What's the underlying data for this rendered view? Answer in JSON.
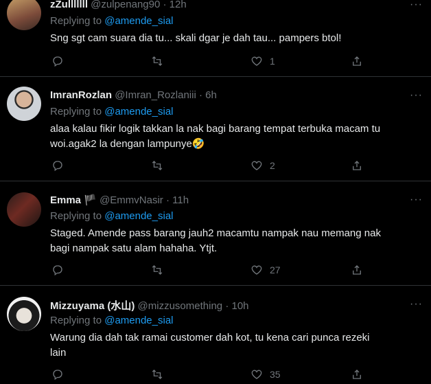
{
  "tweets": [
    {
      "name": "zZulllllll",
      "handle": "@zulpenang90",
      "sep": "·",
      "time": "12h",
      "replying_prefix": "Replying to",
      "replying_to": "@amende_sial",
      "text": "Sng sgt cam suara dia tu... skali dgar je dah tau... pampers btol!",
      "likes": "1",
      "more": "···"
    },
    {
      "name": "ImranRozlan",
      "handle": "@Imran_Rozlaniii",
      "sep": "·",
      "time": "6h",
      "replying_prefix": "Replying to",
      "replying_to": "@amende_sial",
      "text_line1": "alaa kalau fikir logik takkan la nak bagi barang tempat terbuka macam tu",
      "text_line2": "woi.agak2 la dengan lampunye🤣",
      "likes": "2",
      "more": "···"
    },
    {
      "name": "Emma",
      "handle": "@EmmvNasir",
      "sep": "·",
      "time": "11h",
      "replying_prefix": "Replying to",
      "replying_to": "@amende_sial",
      "text_line1": "Staged. Amende pass barang jauh2 macamtu nampak nau memang nak",
      "text_line2": "bagi nampak satu alam hahaha. Ytjt.",
      "likes": "27",
      "more": "···"
    },
    {
      "name": "Mizzuyama (水山)",
      "handle": "@mizzusomething",
      "sep": "·",
      "time": "10h",
      "replying_prefix": "Replying to",
      "replying_to": "@amende_sial",
      "text_line1": "Warung dia dah tak ramai customer dah kot, tu kena cari punca rezeki",
      "text_line2": "lain",
      "likes": "35",
      "more": "···"
    }
  ]
}
